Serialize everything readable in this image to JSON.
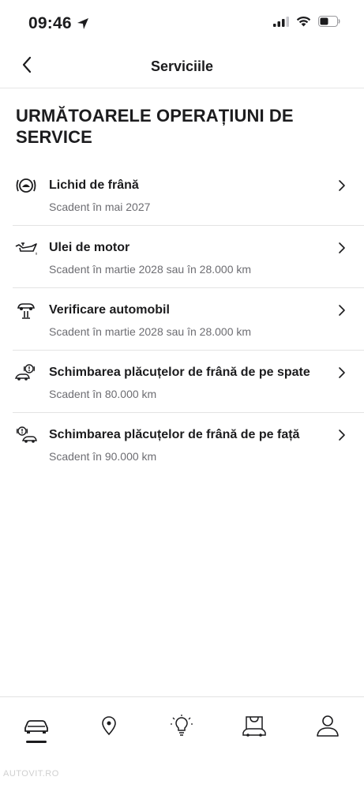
{
  "status_bar": {
    "time": "09:46",
    "icons": [
      "location-arrow-icon",
      "cellular-signal-icon",
      "wifi-icon",
      "battery-icon"
    ]
  },
  "header": {
    "title": "Serviciile",
    "back_icon": "chevron-left-icon"
  },
  "section": {
    "title": "URMĂTOARELE OPERAȚIUNI DE SERVICE"
  },
  "services": [
    {
      "icon": "brake-fluid-icon",
      "title": "Lichid de frână",
      "subtitle": "Scadent în mai 2027"
    },
    {
      "icon": "engine-oil-icon",
      "title": "Ulei de motor",
      "subtitle": "Scadent în martie 2028 sau în 28.000 km"
    },
    {
      "icon": "vehicle-lift-icon",
      "title": "Verificare automobil",
      "subtitle": "Scadent în martie 2028 sau în 28.000 km"
    },
    {
      "icon": "rear-brake-pads-icon",
      "title": "Schimbarea plăcuțelor de frână de pe spate",
      "subtitle": "Scadent în 80.000 km"
    },
    {
      "icon": "front-brake-pads-icon",
      "title": "Schimbarea plăcuțelor de frână de pe față",
      "subtitle": "Scadent în 90.000 km"
    }
  ],
  "tabbar": {
    "tabs": [
      "car-icon",
      "map-pin-icon",
      "lightbulb-icon",
      "shop-icon",
      "profile-icon"
    ],
    "active": "car-icon"
  },
  "watermark": "AUTOVIT.RO"
}
